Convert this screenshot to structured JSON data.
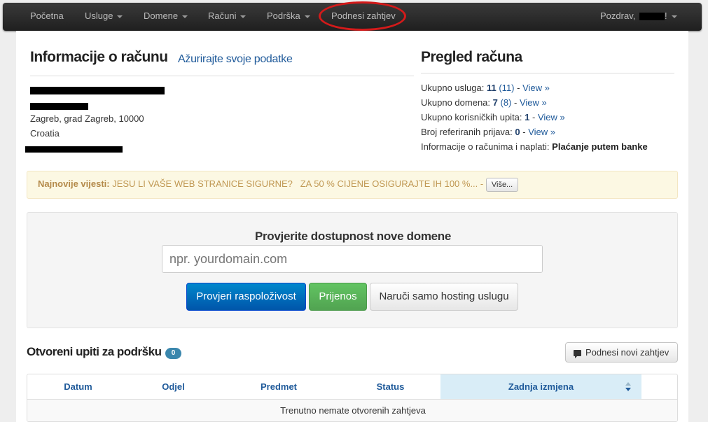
{
  "nav": {
    "home": "Početna",
    "services": "Usluge",
    "domains": "Domene",
    "billing": "Računi",
    "support": "Podrška",
    "submit_ticket": "Podnesi zahtjev",
    "greeting": "Pozdrav,",
    "greeting_suffix": "!"
  },
  "account": {
    "title": "Informacije o računu",
    "update_link": "Ažurirajte svoje podatke",
    "city_line": "Zagreb, grad Zagreb, 10000",
    "country": "Croatia"
  },
  "overview": {
    "title": "Pregled računa",
    "services_label": "Ukupno usluga:",
    "services_active": "11",
    "services_total": "(11)",
    "domains_label": "Ukupno domena:",
    "domains_active": "7",
    "domains_total": "(8)",
    "tickets_label": "Ukupno korisničkih upita:",
    "tickets_count": "1",
    "referrals_label": "Broj referiranih prijava:",
    "referrals_count": "0",
    "payment_label": "Informacije o računima i naplati:",
    "payment_method": "Plaćanje putem banke",
    "view_link": "View »",
    "separator": " - "
  },
  "news": {
    "label": "Najnovije vijesti:",
    "text": "JESU LI VAŠE WEB STRANICE SIGURNE?   ZA 50 % CIJENE OSIGURAJTE IH 100 %...",
    "separator": " - ",
    "more_button": "Više..."
  },
  "domain_check": {
    "title": "Provjerite dostupnost nove domene",
    "placeholder": "npr. yourdomain.com",
    "check_button": "Provjeri raspoloživost",
    "transfer_button": "Prijenos",
    "hosting_button": "Naruči samo hosting uslugu"
  },
  "tickets": {
    "title": "Otvoreni upiti za podršku",
    "count": "0",
    "new_button": "Podnesi novi zahtjev",
    "columns": [
      "Datum",
      "Odjel",
      "Predmet",
      "Status",
      "Zadnja izmjena"
    ],
    "empty_message": "Trenutno nemate otvorenih zahtjeva"
  },
  "colors": {
    "navbar": "#2b2b2b",
    "link": "#1f5a9a",
    "primary_button": "#0066cc",
    "success_button": "#5bb75b",
    "warning_bg": "#fcf8e3",
    "badge": "#3a87ad",
    "highlight": "#d41a1a"
  },
  "icons": {
    "sort": "sort-icon",
    "comment": "comment-icon"
  }
}
